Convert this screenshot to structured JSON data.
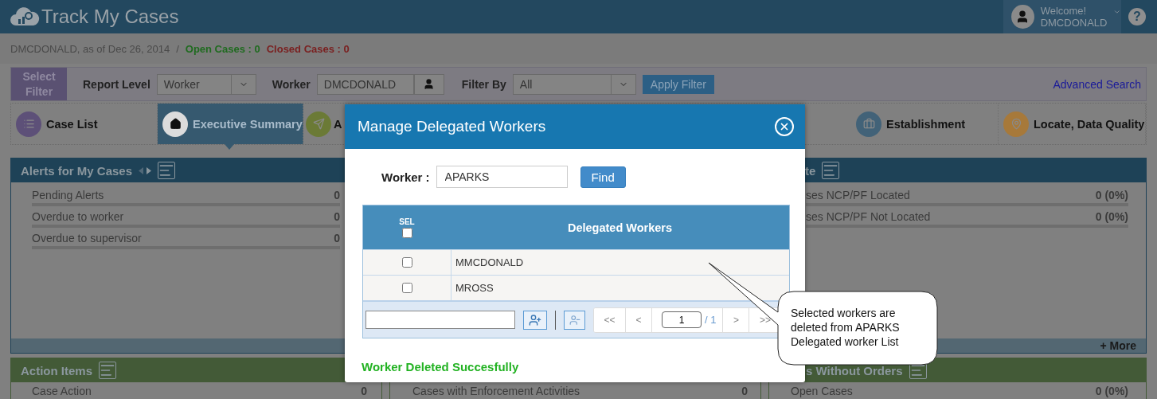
{
  "header": {
    "title": "Track My Cases",
    "welcome": "Welcome!",
    "user": "DMCDONALD",
    "help": "?"
  },
  "breadcrumb": {
    "owner": "DMCDONALD, as of Dec 26, 2014",
    "separator": "/",
    "open": "Open Cases : 0",
    "closed": "Closed Cases : 0"
  },
  "filter": {
    "label": "Select Filter",
    "report_level_label": "Report Level",
    "report_level": "Worker",
    "worker_label": "Worker",
    "worker": "DMCDONALD",
    "filter_by_label": "Filter By",
    "filter_by": "All",
    "apply": "Apply Filter",
    "advanced": "Advanced Search"
  },
  "tabs": [
    {
      "label": "Case List",
      "kind": "list",
      "color": "#5d5078",
      "selected": false
    },
    {
      "label": "Executive Summary",
      "kind": "home",
      "color": "#dcdcdc",
      "selected": true
    },
    {
      "label": "A",
      "kind": "send",
      "color": "#6b7a36",
      "selected": false
    },
    {
      "label": "Establishment",
      "kind": "briefcase",
      "color": "#426278",
      "selected": false
    },
    {
      "label": "Locate, Data Quality",
      "kind": "pin",
      "color": "#a7793a",
      "selected": false
    }
  ],
  "panel_rows": [
    {
      "left": {
        "title": "Alerts for My Cases",
        "color": "#1e4257",
        "arrows": true,
        "items": [
          {
            "label": "Pending Alerts",
            "value": "0"
          },
          {
            "label": "Overdue to worker",
            "value": "0"
          },
          {
            "label": "Overdue to supervisor",
            "value": "0"
          }
        ]
      },
      "right": {
        "title": "te",
        "color": "#1e4257",
        "arrows": false,
        "more": "+ More",
        "items": [
          {
            "label": "ses NCP/PF Located",
            "value": "0 (0%)"
          },
          {
            "label": "ses NCP/PF Not Located",
            "value": "0 (0%)"
          }
        ]
      }
    },
    {
      "left": {
        "title": "Action Items",
        "color": "#435a37",
        "arrows": false,
        "items": [
          {
            "label": "Case Action",
            "value": "0"
          }
        ]
      },
      "middle": {
        "color": "#435a37",
        "items": [
          {
            "label": "Cases with Enforcement Activities",
            "value": "0"
          }
        ]
      },
      "right": {
        "title": "s Without Orders",
        "color": "#435a37",
        "arrows": false,
        "items": [
          {
            "label": "Open Cases",
            "value": "0 (0%)"
          }
        ]
      }
    }
  ],
  "modal": {
    "title": "Manage Delegated Workers",
    "worker_label": "Worker :",
    "worker": "APARKS",
    "find": "Find",
    "table": {
      "sel_label": "SEL",
      "select_all": {
        "checked": false
      },
      "column": "Delegated Workers",
      "rows": [
        {
          "name": "MMCDONALD",
          "checked": false
        },
        {
          "name": "MROSS",
          "checked": false
        }
      ]
    },
    "pager": {
      "first": "<<",
      "prev": "<",
      "page": "1",
      "total": "/ 1",
      "next": ">",
      "last": ">>"
    },
    "message": "Worker Deleted Succesfully"
  },
  "callout": "Selected workers are deleted from APARKS Delegated worker List"
}
